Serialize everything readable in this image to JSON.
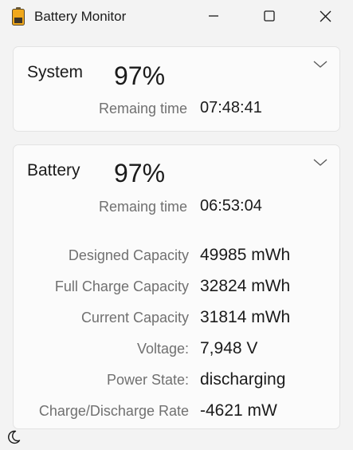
{
  "window": {
    "title": "Battery Monitor",
    "accent_icon_color": "#f0a81c"
  },
  "system": {
    "name": "System",
    "percent": "97%",
    "remaining_label": "Remaing time",
    "remaining_value": "07:48:41"
  },
  "battery": {
    "name": "Battery",
    "percent": "97%",
    "remaining_label": "Remaing time",
    "remaining_value": "06:53:04",
    "details": [
      {
        "label": "Designed Capacity",
        "value": "49985 mWh"
      },
      {
        "label": "Full Charge Capacity",
        "value": "32824 mWh"
      },
      {
        "label": "Current Capacity",
        "value": "31814 mWh"
      },
      {
        "label": "Voltage:",
        "value": "7,948 V"
      },
      {
        "label": "Power State:",
        "value": "discharging"
      },
      {
        "label": "Charge/Discharge Rate",
        "value": "-4621 mW"
      }
    ]
  },
  "icons": {
    "app": "battery-icon",
    "minimize": "minimize-icon",
    "maximize": "maximize-icon",
    "close": "close-icon",
    "expand": "chevron-down-icon",
    "theme": "moon-icon"
  }
}
